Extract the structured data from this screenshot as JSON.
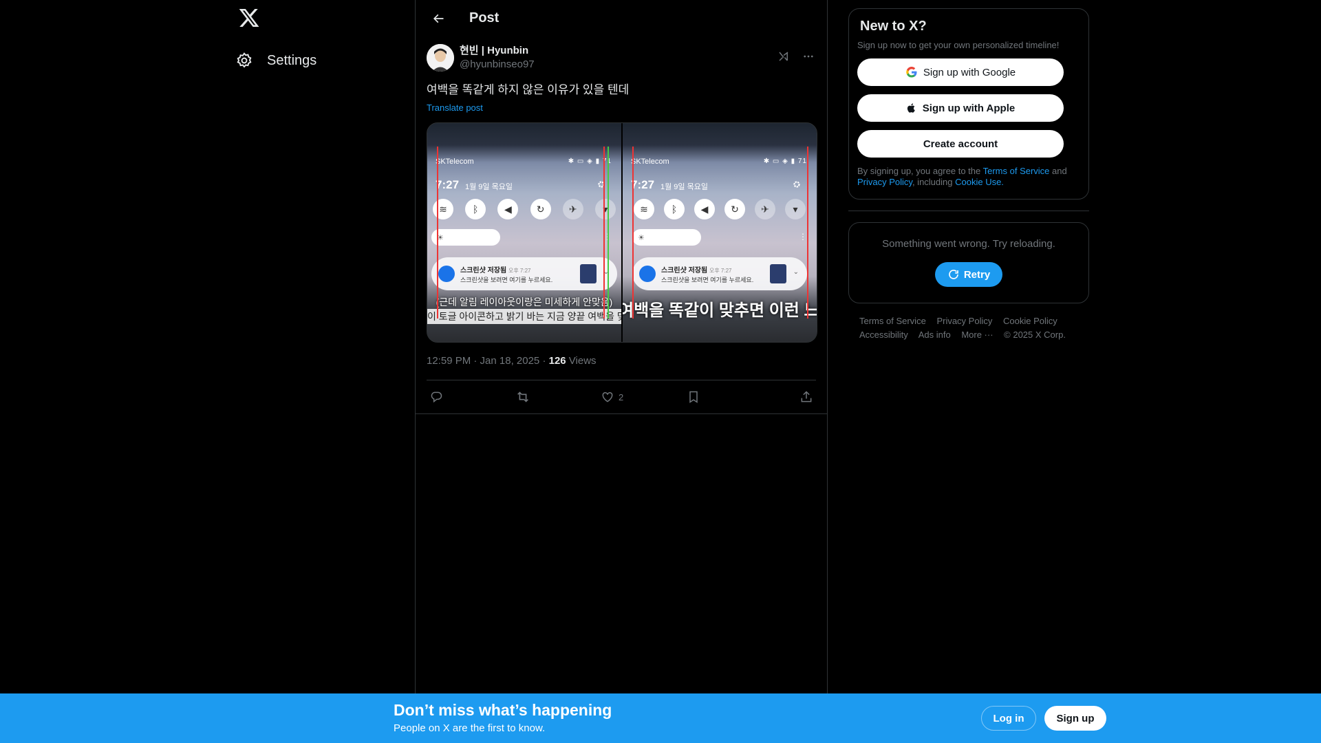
{
  "nav": {
    "settings_label": "Settings"
  },
  "header": {
    "title": "Post"
  },
  "post": {
    "display_name": "현빈 | Hyunbin",
    "handle": "@hyunbinseo97",
    "text": "여백을 똑같게 하지 않은 이유가 있을 텐데",
    "translate_label": "Translate post",
    "time": "12:59 PM · Jan 18, 2025 · ",
    "views_count": "126",
    "views_label": " Views",
    "likes": "2",
    "media": {
      "carrier": "SKTelecom",
      "clock": "7:27",
      "date": "1월 9일 목요일",
      "battery": "71",
      "notif_title": "스크린샷 저장됨",
      "notif_time": "오후 7:27",
      "notif_sub": "스크린샷을 보려면 여기를 누르세요.",
      "caption_left_1": "(근데 알림 레이아웃이랑은 미세하게 안맞음)",
      "caption_left_2": "이 토글 아이콘하고 밝기 바는 지금 양끝 여백을 맞춰놨",
      "caption_right": "여백을 똑같이 맞추면 이런 느"
    }
  },
  "sidebar": {
    "new_title": "New to X?",
    "new_sub": "Sign up now to get your own personalized timeline!",
    "google": "Sign up with Google",
    "apple": "Sign up with Apple",
    "create": "Create account",
    "legal_1": "By signing up, you agree to the ",
    "terms": "Terms of Service",
    "legal_2": " and ",
    "privacy": "Privacy Policy",
    "legal_3": ", including ",
    "cookie": "Cookie Use.",
    "error": "Something went wrong. Try reloading.",
    "retry": "Retry",
    "footer": [
      "Terms of Service",
      "Privacy Policy",
      "Cookie Policy",
      "Accessibility",
      "Ads info",
      "More ···",
      "© 2025 X Corp."
    ]
  },
  "banner": {
    "title": "Don’t miss what’s happening",
    "subtitle": "People on X are the first to know.",
    "login": "Log in",
    "signup": "Sign up"
  },
  "colors": {
    "accent": "#1d9bf0",
    "background": "#000000",
    "border": "#2f3336",
    "muted": "#71767b"
  }
}
